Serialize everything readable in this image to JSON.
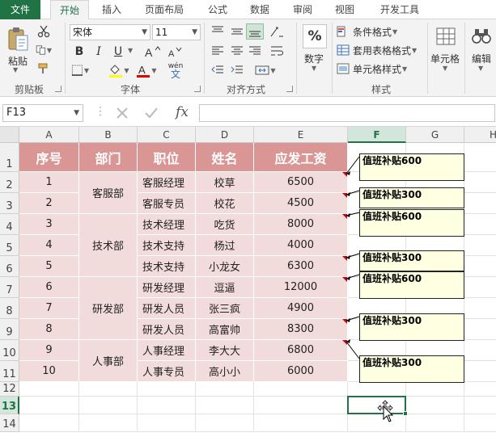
{
  "ribbon": {
    "tabs": [
      "文件",
      "开始",
      "插入",
      "页面布局",
      "公式",
      "数据",
      "审阅",
      "视图",
      "开发工具"
    ],
    "clipboard": {
      "paste_label": "粘贴",
      "group_label": "剪贴板"
    },
    "font": {
      "font_name": "宋体",
      "font_size": "11",
      "group_label": "字体",
      "bold": "B",
      "italic": "I",
      "underline": "U",
      "phonetic_top": "wén",
      "phonetic_bottom": "文"
    },
    "alignment": {
      "group_label": "对齐方式"
    },
    "number": {
      "label": "数字",
      "format": "%"
    },
    "styles": {
      "conditional": "条件格式",
      "table": "套用表格格式",
      "cell_styles": "单元格样式",
      "group_label": "样式"
    },
    "cells": {
      "label": "单元格"
    },
    "editing": {
      "label": "编辑"
    }
  },
  "formula_bar": {
    "name_box": "F13",
    "formula": "",
    "fx": "fx"
  },
  "sheet": {
    "columns": [
      "A",
      "B",
      "C",
      "D",
      "E",
      "F",
      "G",
      "H"
    ],
    "selected_column": "F",
    "rows": [
      "1",
      "2",
      "3",
      "4",
      "5",
      "6",
      "7",
      "8",
      "9",
      "10",
      "11",
      "12",
      "13",
      "14"
    ],
    "selected_row": "13",
    "headers": [
      "序号",
      "部门",
      "职位",
      "姓名",
      "应发工资"
    ],
    "departments": [
      "客服部",
      "技术部",
      "研发部",
      "人事部"
    ],
    "records": [
      [
        "1",
        "客服经理",
        "校草",
        "6500"
      ],
      [
        "2",
        "客服专员",
        "校花",
        "4500"
      ],
      [
        "3",
        "技术经理",
        "吃货",
        "8000"
      ],
      [
        "4",
        "技术支持",
        "杨过",
        "4000"
      ],
      [
        "5",
        "技术支持",
        "小龙女",
        "6300"
      ],
      [
        "6",
        "研发经理",
        "逗逼",
        "12000"
      ],
      [
        "7",
        "研发人员",
        "张三疯",
        "4900"
      ],
      [
        "8",
        "研发人员",
        "高富帅",
        "8300"
      ],
      [
        "9",
        "人事经理",
        "李大大",
        "6800"
      ],
      [
        "10",
        "人事专员",
        "高小小",
        "6000"
      ]
    ],
    "comments": [
      "值班补贴600",
      "值班补贴300",
      "值班补贴600",
      "值班补贴300",
      "值班补贴600",
      "值班补贴300",
      "值班补贴300"
    ]
  },
  "colors": {
    "accent": "#217346",
    "header_fill": "#da9694",
    "body_fill": "#f2dcdb",
    "comment_fill": "#ffffe1",
    "comment_marker": "#cc0000"
  }
}
